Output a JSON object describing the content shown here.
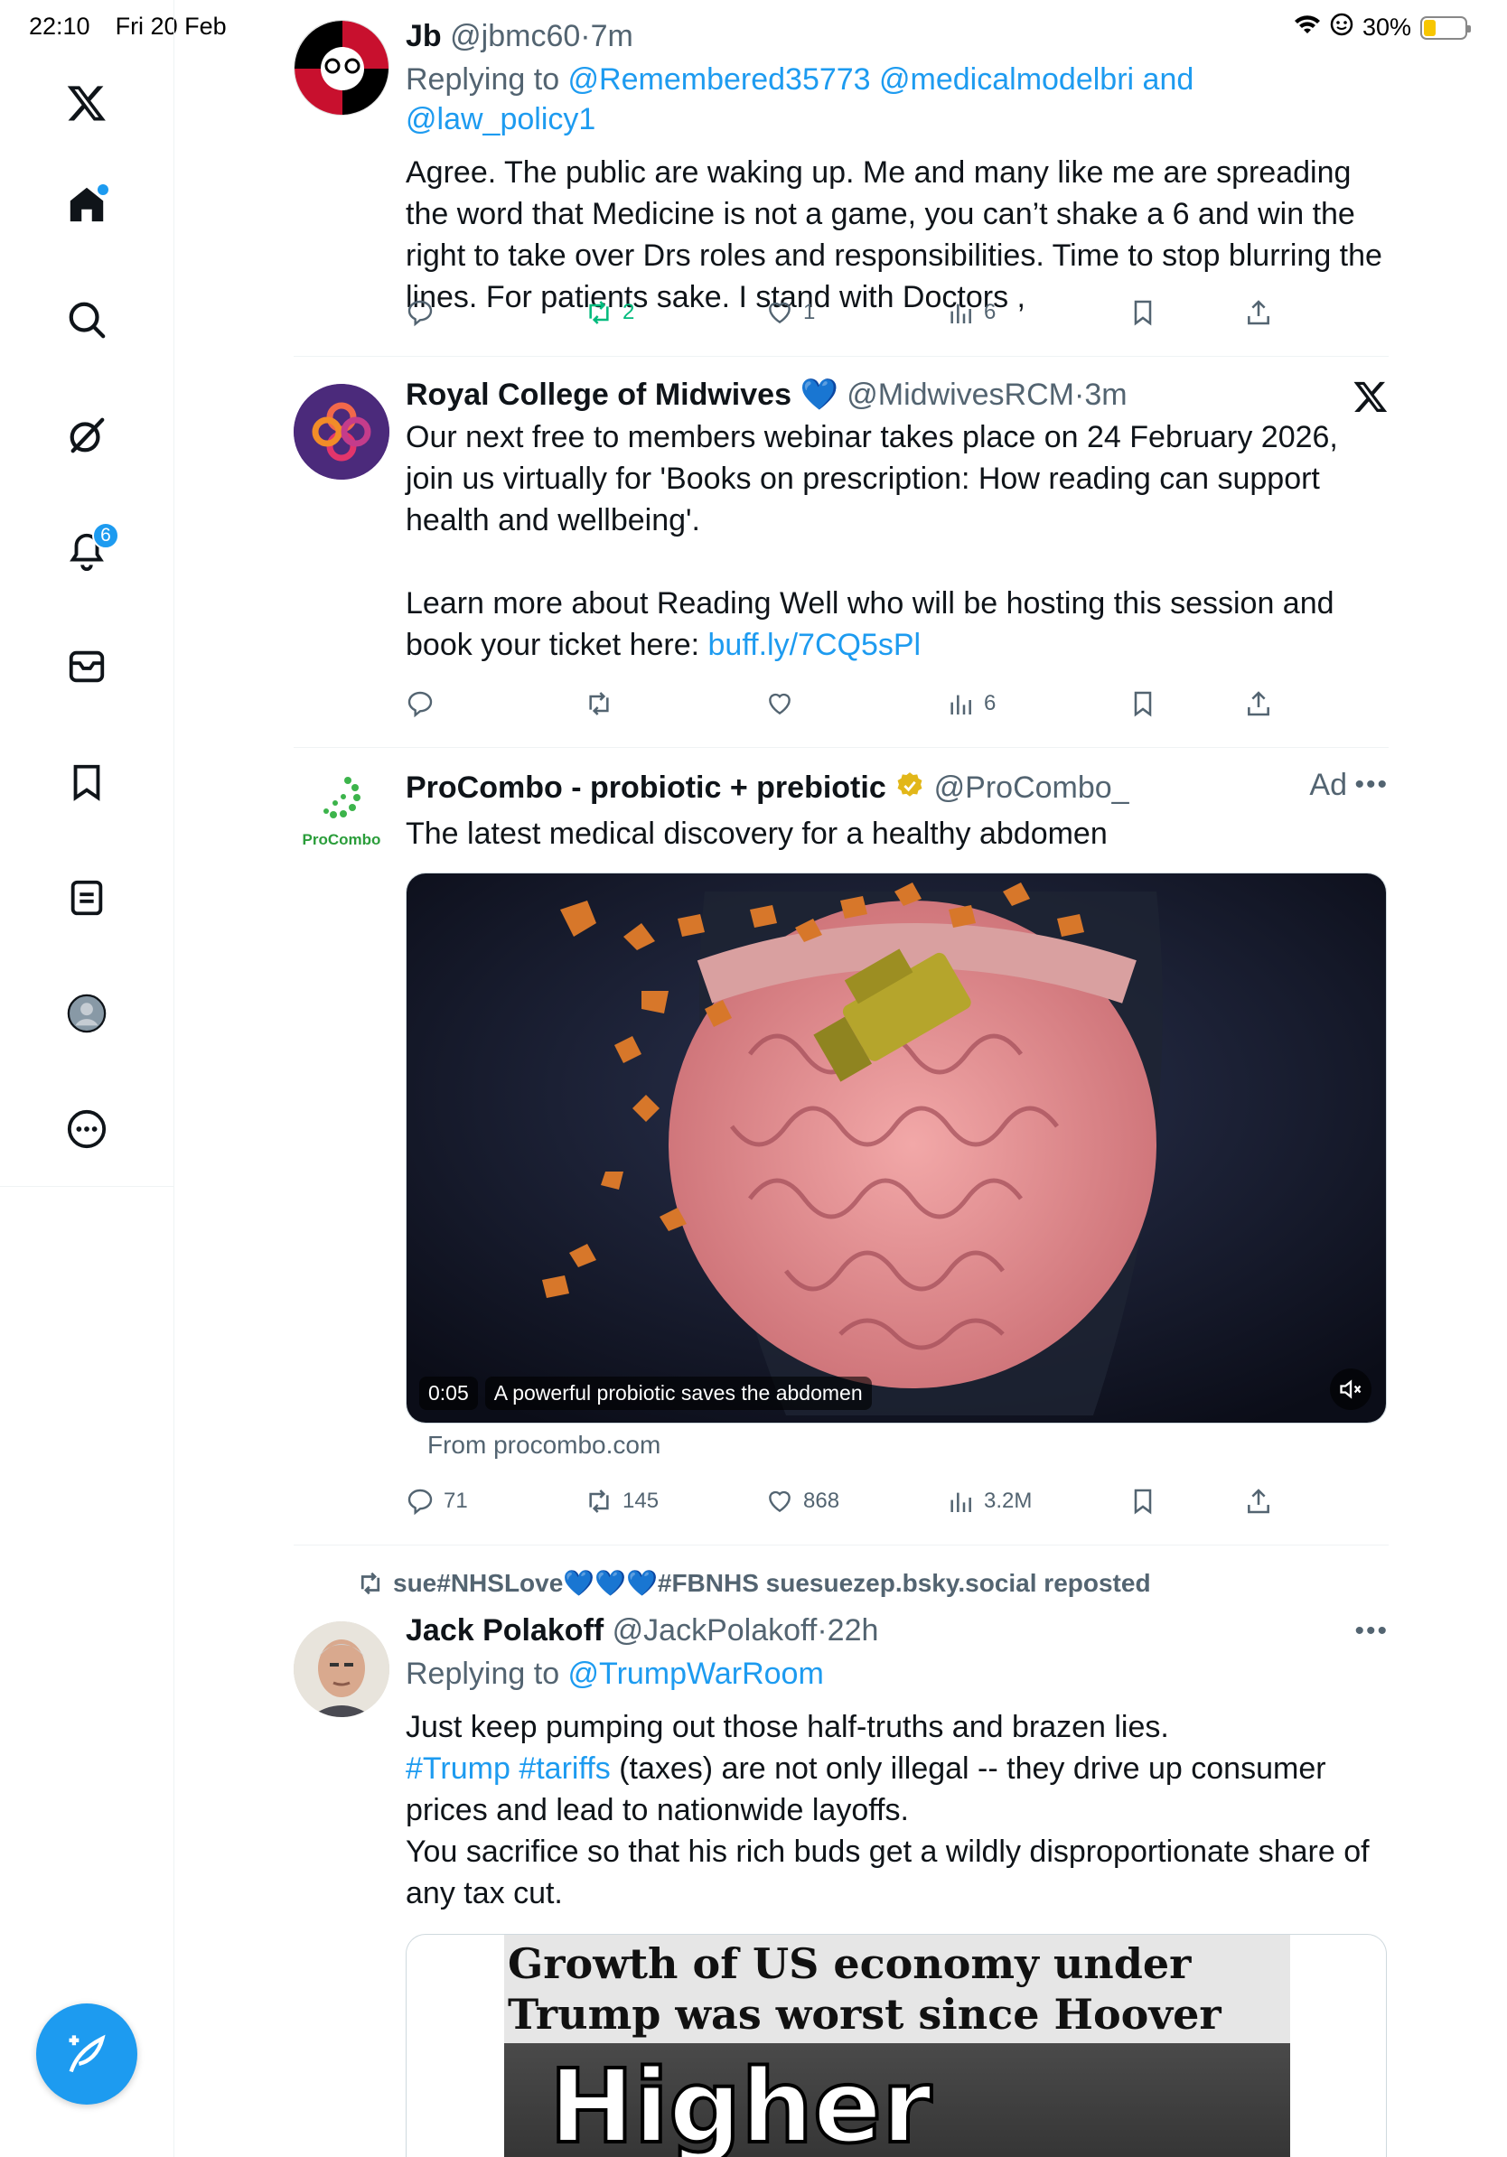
{
  "status_bar": {
    "time": "22:10",
    "date": "Fri 20 Feb",
    "battery": "30%",
    "battery_level": 0.3
  },
  "sidebar": {
    "items": [
      {
        "name": "x-logo-icon"
      },
      {
        "name": "home-icon",
        "has_dot": true
      },
      {
        "name": "search-icon"
      },
      {
        "name": "grok-icon"
      },
      {
        "name": "notifications-icon",
        "badge": "6"
      },
      {
        "name": "messages-icon"
      },
      {
        "name": "bookmarks-icon"
      },
      {
        "name": "lists-icon"
      },
      {
        "name": "profile-icon"
      },
      {
        "name": "more-icon"
      }
    ],
    "accent": "#1d9bf0"
  },
  "posts": [
    {
      "name": "Jb",
      "handle": "@jbmc60",
      "time": "7m",
      "reply_prefix": "Replying to ",
      "reply_targets": "@Remembered35773 @medicalmodelbri and @law_policy1",
      "text": "Agree. The public are waking up. Me and many like me are spreading the word that Medicine is not a game, you can’t shake a 6 and win the right to take over Drs roles and responsibilities. Time to stop blurring the lines. For patients sake. I stand with Doctors ,",
      "replies": "",
      "reposts": "2",
      "likes": "1",
      "views": "6"
    },
    {
      "name": "Royal College of Midwives",
      "emoji": "💙",
      "handle": "@MidwivesRCM",
      "time": "3m",
      "text_1": "Our next free to members webinar takes place on 24 February 2026, join us virtually for 'Books on prescription: How reading can support health and wellbeing'.",
      "text_2": "Learn more about Reading Well who will be hosting this session and book your ticket here: ",
      "link": "buff.ly/7CQ5sPl",
      "views": "6"
    },
    {
      "name": "ProCombo - probiotic + prebiotic",
      "handle": "@ProCombo_",
      "ad_label": "Ad",
      "avatar_text": "ProCombo",
      "text": "The latest medical discovery for a healthy abdomen",
      "video_time": "0:05",
      "video_caption": "A powerful probiotic saves the abdomen",
      "source": "From procombo.com",
      "replies": "71",
      "reposts": "145",
      "likes": "868",
      "views": "3.2M"
    },
    {
      "repost_by": "sue#NHSLove💙💙💙#FBNHS suesuezep.bsky.social reposted",
      "name": "Jack Polakoff",
      "handle": "@JackPolakoff",
      "time": "22h",
      "reply_prefix": "Replying to ",
      "reply_targets": "@TrumpWarRoom",
      "text_1": "Just keep pumping out those half-truths and brazen lies.",
      "hashtags": "#Trump #tariffs",
      "text_2": " (taxes) are not only illegal -- they drive up consumer prices and lead to nationwide layoffs.",
      "text_3": "You sacrifice so that his rich buds get a wildly disproportionate share of any tax cut.",
      "image_headline": "Growth of US economy under Trump was worst since Hoover",
      "image_word": "Higher"
    }
  ],
  "separator": "·"
}
